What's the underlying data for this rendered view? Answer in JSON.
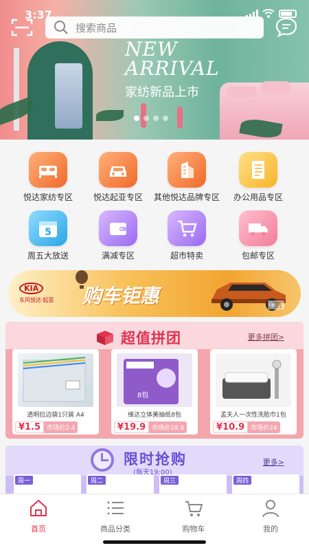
{
  "status": {
    "time": "3:37"
  },
  "search": {
    "placeholder": "搜索商品"
  },
  "banner": {
    "title_line1": "NEW",
    "title_line2": "ARRIVAL",
    "subtitle": "家纺新品上市",
    "dots": 4,
    "active_dot": 0
  },
  "categories": [
    {
      "label": "悦达家纺专区",
      "icon": "bed-icon",
      "color": "orange"
    },
    {
      "label": "悦达起亚专区",
      "icon": "car-icon",
      "color": "orange"
    },
    {
      "label": "其他悦达品牌专区",
      "icon": "building-icon",
      "color": "orange"
    },
    {
      "label": "办公用品专区",
      "icon": "notebook-icon",
      "color": "yellow"
    },
    {
      "label": "周五大放送",
      "icon": "calendar-5-icon",
      "color": "blue"
    },
    {
      "label": "满减专区",
      "icon": "wallet-icon",
      "color": "purple"
    },
    {
      "label": "超市特卖",
      "icon": "cart-icon",
      "color": "purple"
    },
    {
      "label": "包邮专区",
      "icon": "truck-icon",
      "color": "pink"
    }
  ],
  "kia_banner": {
    "brand": "KIA",
    "brand_sub": "东风悦达·起亚",
    "slogan": "购车钜惠",
    "tag": "广告"
  },
  "group_buy": {
    "title": "超值拼团",
    "more": "更多拼团>",
    "products": [
      {
        "name": "透明拉边袋1只装 A4",
        "price": "¥1.5",
        "market": "市场价2.4"
      },
      {
        "name": "维达立体美抽纸8包",
        "price": "¥19.9",
        "market": "市场价28.8"
      },
      {
        "name": "孟夫人一次性洗脸巾1包",
        "price": "¥10.9",
        "market": "市场价24"
      }
    ]
  },
  "flash_sale": {
    "title": "限时抢购",
    "subtitle": "(每天19:00)",
    "more": "更多>",
    "cards": [
      "周一",
      "周二",
      "周三",
      "周四"
    ]
  },
  "tabbar": {
    "tabs": [
      {
        "label": "首页",
        "icon": "home-icon",
        "active": true
      },
      {
        "label": "商品分类",
        "icon": "list-icon",
        "active": false
      },
      {
        "label": "购物车",
        "icon": "cart-icon",
        "active": false
      },
      {
        "label": "我的",
        "icon": "user-icon",
        "active": false
      }
    ]
  },
  "colors": {
    "accent": "#e0334f",
    "group_bg": "#f3a6ad",
    "flash_bg": "#cdbdf6"
  }
}
